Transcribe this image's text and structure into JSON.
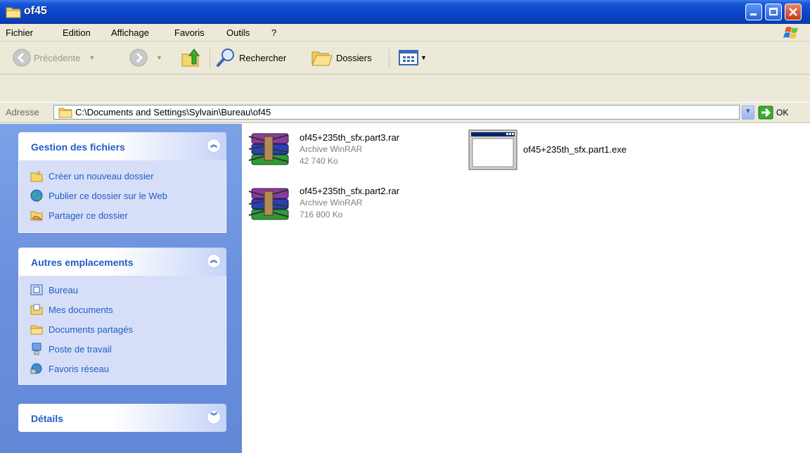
{
  "window": {
    "title": "of45",
    "colors": {
      "titlebar": "#0a45c9",
      "menubar": "#ece9d8",
      "sidebar": "#6b8fde",
      "link": "#215dc6"
    }
  },
  "menu": {
    "items": [
      "Fichier",
      "Edition",
      "Affichage",
      "Favoris",
      "Outils",
      "?"
    ]
  },
  "toolbar": {
    "back_label": "Précédente",
    "search_label": "Rechercher",
    "folders_label": "Dossiers"
  },
  "address": {
    "label": "Adresse",
    "value": "C:\\Documents and Settings\\Sylvain\\Bureau\\of45",
    "go_label": "OK"
  },
  "sidebar": {
    "panels": [
      {
        "title": "Gestion des fichiers",
        "items": [
          {
            "label": "Créer un nouveau dossier",
            "icon": "new-folder-icon"
          },
          {
            "label": "Publier ce dossier sur le Web",
            "icon": "web-publish-icon"
          },
          {
            "label": "Partager ce dossier",
            "icon": "share-folder-icon"
          }
        ]
      },
      {
        "title": "Autres emplacements",
        "items": [
          {
            "label": "Bureau",
            "icon": "desktop-icon"
          },
          {
            "label": "Mes documents",
            "icon": "my-documents-icon"
          },
          {
            "label": "Documents partagés",
            "icon": "shared-documents-icon"
          },
          {
            "label": "Poste de travail",
            "icon": "my-computer-icon"
          },
          {
            "label": "Favoris réseau",
            "icon": "network-places-icon"
          }
        ]
      },
      {
        "title": "Détails",
        "items": []
      }
    ]
  },
  "files": [
    {
      "name": "of45+235th_sfx.part3.rar",
      "type": "Archive WinRAR",
      "size": "42 740 Ko",
      "icon": "winrar-archive-icon"
    },
    {
      "name": "of45+235th_sfx.part1.exe",
      "type": "",
      "size": "",
      "icon": "exe-window-icon"
    },
    {
      "name": "of45+235th_sfx.part2.rar",
      "type": "Archive WinRAR",
      "size": "716 800 Ko",
      "icon": "winrar-archive-icon"
    }
  ]
}
